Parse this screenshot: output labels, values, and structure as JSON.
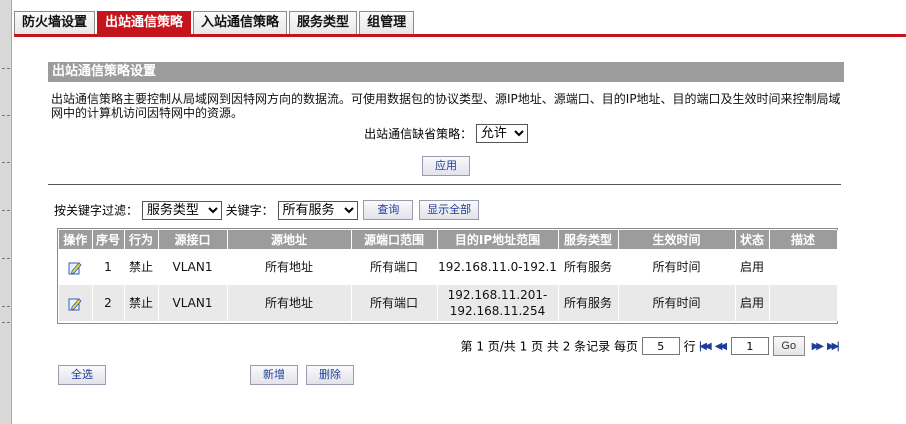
{
  "tabs": [
    {
      "label": "防火墙设置",
      "active": false
    },
    {
      "label": "出站通信策略",
      "active": true
    },
    {
      "label": "入站通信策略",
      "active": false
    },
    {
      "label": "服务类型",
      "active": false
    },
    {
      "label": "组管理",
      "active": false
    }
  ],
  "section": {
    "title": "出站通信策略设置",
    "description": "出站通信策略主要控制从局域网到因特网方向的数据流。可使用数据包的协议类型、源IP地址、源端口、目的IP地址、目的端口及生效时间来控制局域网中的计算机访问因特网中的资源。"
  },
  "default_policy": {
    "label": "出站通信缺省策略：",
    "value": "允许",
    "apply_label": "应用"
  },
  "filter": {
    "label": "按关键字过滤：",
    "type_value": "服务类型",
    "keyword_label": "关键字：",
    "keyword_value": "所有服务",
    "query_label": "查询",
    "show_all_label": "显示全部"
  },
  "table": {
    "headers": [
      "操作",
      "序号",
      "行为",
      "源接口",
      "源地址",
      "源端口范围",
      "目的IP地址范围",
      "服务类型",
      "生效时间",
      "状态",
      "描述"
    ],
    "rows": [
      {
        "index": "1",
        "action": "禁止",
        "src_if": "VLAN1",
        "src_addr": "所有地址",
        "src_port": "所有端口",
        "dst_ip": "192.168.11.0-192.1",
        "service": "所有服务",
        "time": "所有时间",
        "status": "启用",
        "desc": ""
      },
      {
        "index": "2",
        "action": "禁止",
        "src_if": "VLAN1",
        "src_addr": "所有地址",
        "src_port": "所有端口",
        "dst_ip": "192.168.11.201-\n192.168.11.254",
        "service": "所有服务",
        "time": "所有时间",
        "status": "启用",
        "desc": ""
      }
    ]
  },
  "pager": {
    "summary": "第 1 页/共 1 页 共 2 条记录 每页",
    "per_page": "5",
    "row_unit": "行",
    "page_input": "1",
    "go_label": "Go"
  },
  "actions": {
    "select_all_label": "全选",
    "add_label": "新增",
    "delete_label": "删除"
  },
  "colors": {
    "accent_red": "#c5141b",
    "header_gray": "#9c9c9c",
    "link_blue": "#1c3d9a"
  }
}
